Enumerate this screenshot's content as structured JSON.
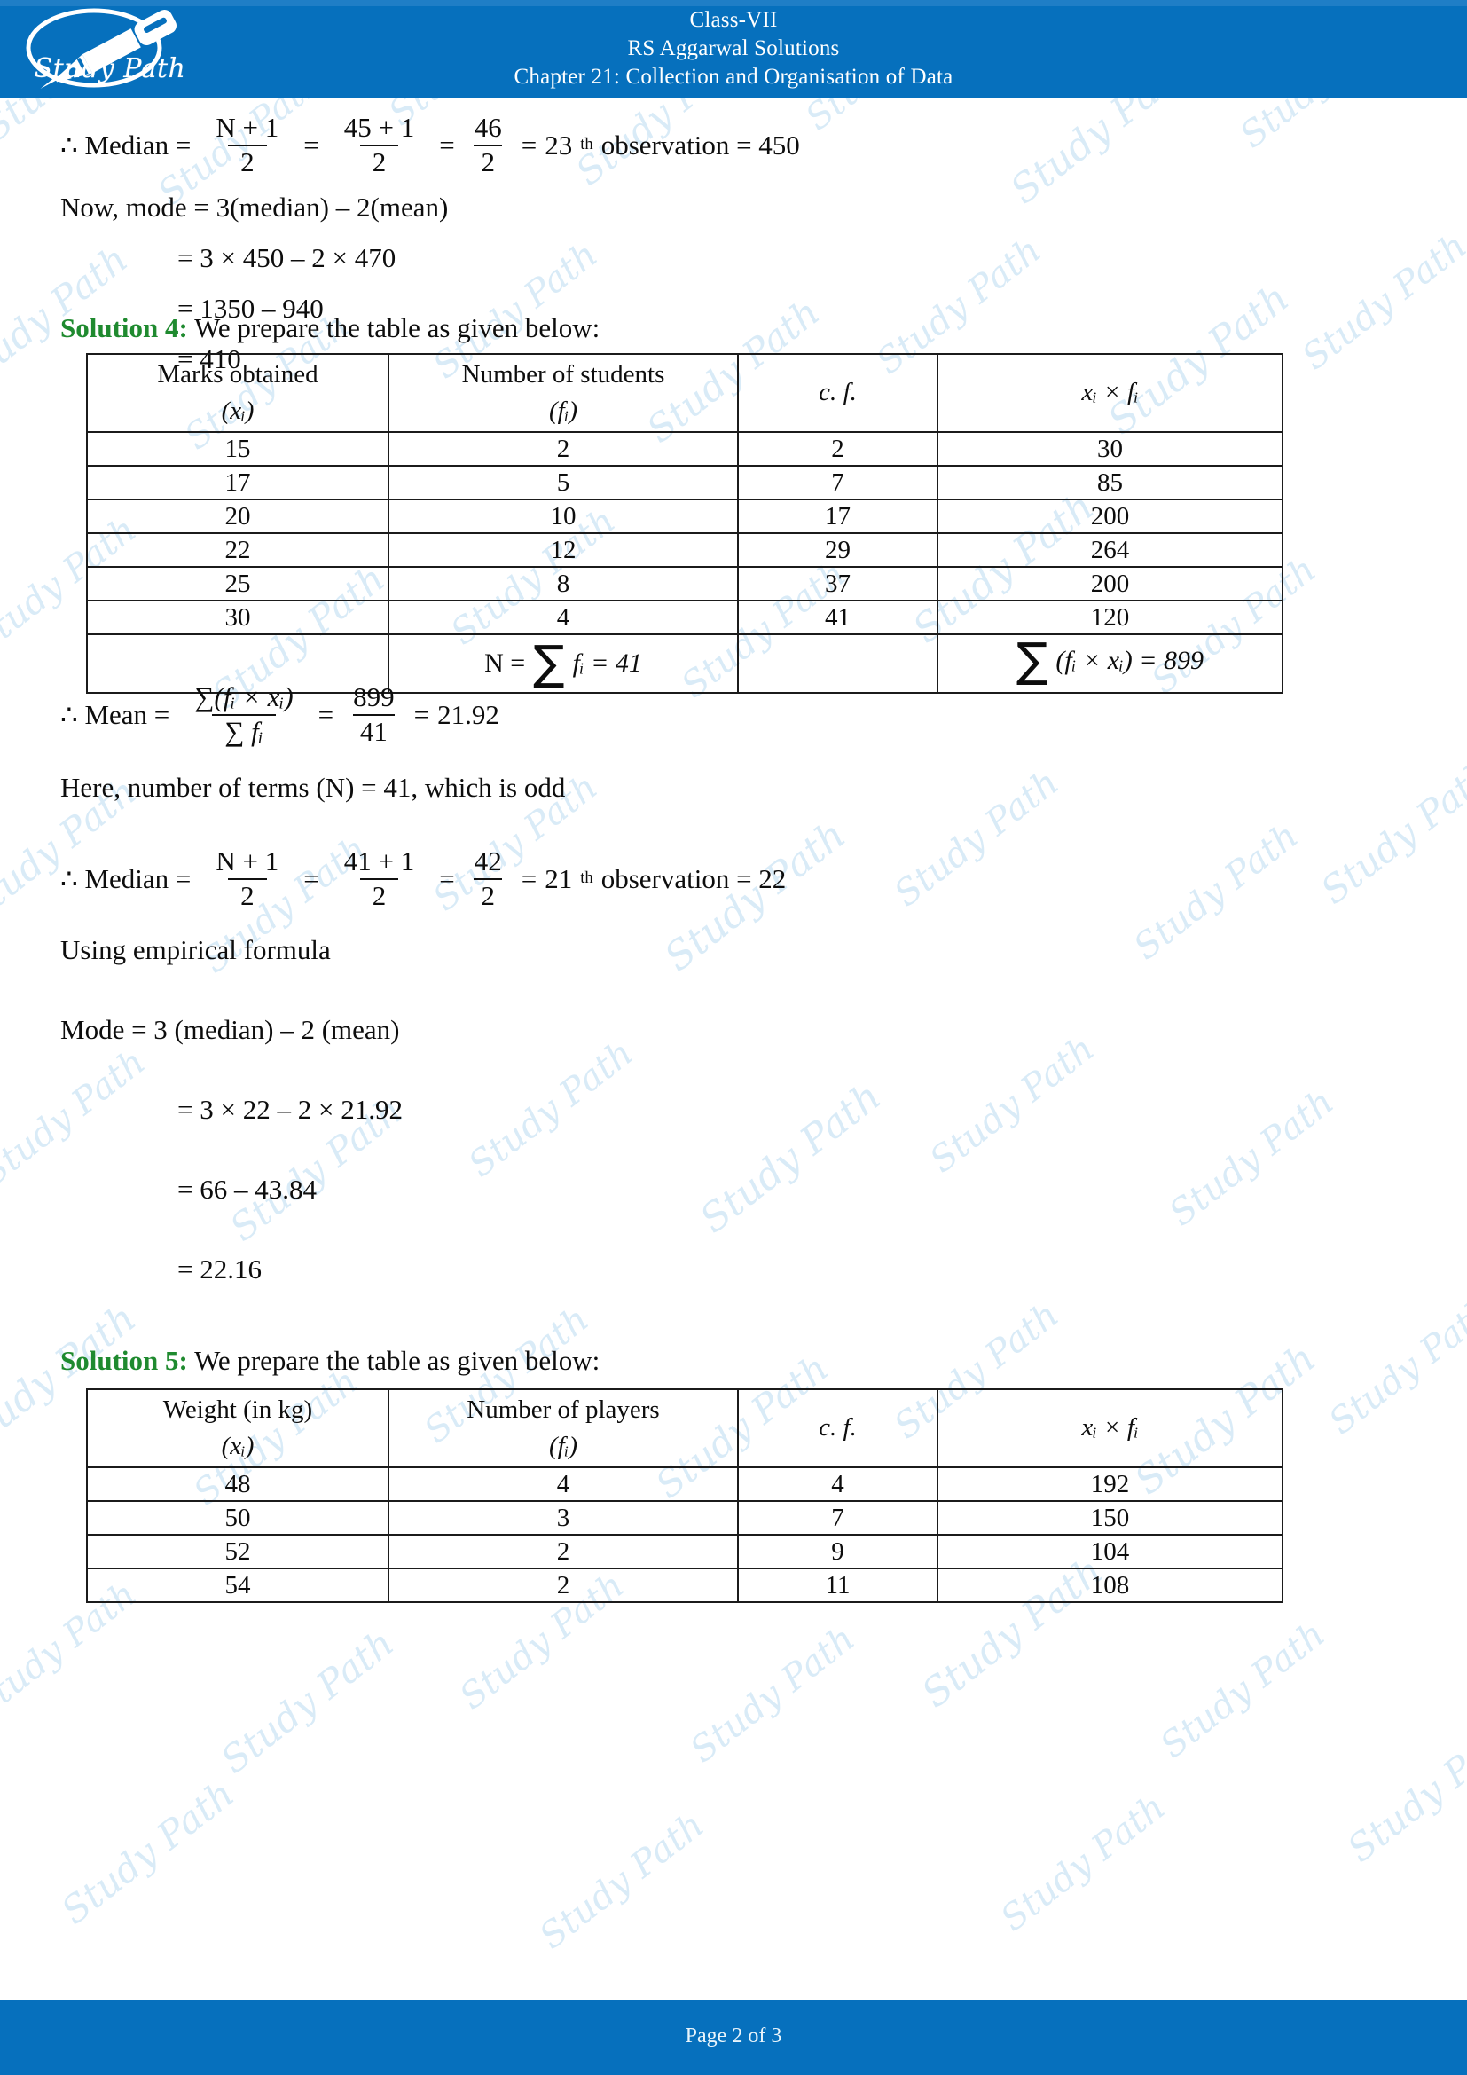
{
  "header": {
    "logo_text": "Study Path",
    "logo_icon": "fountain-pen-icon",
    "line1": "Class-VII",
    "line2": "RS Aggarwal Solutions",
    "line3": "Chapter 21: Collection and Organisation of Data",
    "bg_color": "#0670bd"
  },
  "footer": {
    "page_text": "Page 2 of 3",
    "bg_color": "#0670bd"
  },
  "watermark": {
    "text": "Study Path",
    "color": "#d7eaf7"
  },
  "colors": {
    "accent_blue": "#0670bd",
    "solution_green": "#1f8a2f",
    "rule": "#1b1b1b"
  },
  "solution_3_tail": {
    "median_line": {
      "prefix": "∴ Median =",
      "frac1": {
        "num": "N + 1",
        "den": "2"
      },
      "eq1": "=",
      "frac2": {
        "num": "45 + 1",
        "den": "2"
      },
      "eq2": "=",
      "frac3": {
        "num": "46",
        "den": "2"
      },
      "eq3": "=",
      "result": "23",
      "sup": "th",
      "suffix": "observation = 450"
    },
    "steps": [
      "Now, mode = 3(median) – 2(mean)",
      "= 3 × 450 – 2 × 470",
      "= 1350 – 940",
      "= 410"
    ]
  },
  "solution4": {
    "label": "Solution 4:",
    "intro": "We prepare the table as given below:",
    "table": {
      "headers": [
        {
          "main": "Marks obtained",
          "sub": "(xᵢ)"
        },
        {
          "main": "Number of students",
          "sub": "(fᵢ)"
        },
        {
          "main": "c. f.",
          "sub": ""
        },
        {
          "main": "xᵢ × fᵢ",
          "sub": ""
        }
      ],
      "rows": [
        [
          "15",
          "2",
          "2",
          "30"
        ],
        [
          "17",
          "5",
          "7",
          "85"
        ],
        [
          "20",
          "10",
          "17",
          "200"
        ],
        [
          "22",
          "12",
          "29",
          "264"
        ],
        [
          "25",
          "8",
          "37",
          "200"
        ],
        [
          "30",
          "4",
          "41",
          "120"
        ]
      ],
      "sum_row": {
        "col1": "",
        "col2_prefix": "N =",
        "col2_sigma": "∑",
        "col2_body": "fᵢ = 41",
        "col3": "",
        "col4_sigma": "∑",
        "col4_body": "(fᵢ × xᵢ) = 899"
      }
    },
    "mean_line": {
      "prefix": "∴ Mean =",
      "frac1": {
        "num": "∑(fᵢ × xᵢ)",
        "den": "∑ fᵢ"
      },
      "eq1": "=",
      "frac2": {
        "num": "899",
        "den": "41"
      },
      "eq2": "=",
      "result": "21.92"
    },
    "terms_line": "Here, number of terms (N) = 41, which is odd",
    "median_line": {
      "prefix": "∴ Median =",
      "frac1": {
        "num": "N + 1",
        "den": "2"
      },
      "eq1": "=",
      "frac2": {
        "num": "41 + 1",
        "den": "2"
      },
      "eq2": "=",
      "frac3": {
        "num": "42",
        "den": "2"
      },
      "eq3": "=",
      "result": "21",
      "sup": "th",
      "suffix": "observation = 22"
    },
    "empirical_label": "Using empirical formula",
    "mode_steps": [
      "Mode = 3 (median) – 2 (mean)",
      "= 3 × 22 – 2 × 21.92",
      "= 66 – 43.84",
      "= 22.16"
    ]
  },
  "solution5": {
    "label": "Solution 5:",
    "intro": "We prepare the table as given below:",
    "table": {
      "headers": [
        {
          "main": "Weight (in kg)",
          "sub": "(xᵢ)"
        },
        {
          "main": "Number of players",
          "sub": "(fᵢ)"
        },
        {
          "main": "c. f.",
          "sub": ""
        },
        {
          "main": "xᵢ × fᵢ",
          "sub": ""
        }
      ],
      "rows": [
        [
          "48",
          "4",
          "4",
          "192"
        ],
        [
          "50",
          "3",
          "7",
          "150"
        ],
        [
          "52",
          "2",
          "9",
          "104"
        ],
        [
          "54",
          "2",
          "11",
          "108"
        ]
      ]
    }
  }
}
